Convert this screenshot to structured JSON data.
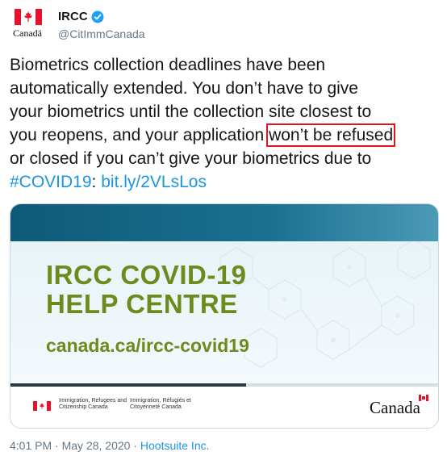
{
  "account": {
    "avatar_wordmark": "Canadä",
    "display_name": "IRCC",
    "handle": "@CitImmCanada"
  },
  "tweet": {
    "line1": "Biometrics collection deadlines have been",
    "line2": "automatically extended. You don’t have to give",
    "line3": "your biometrics until the collection site closest to",
    "line4_before": "you reopens, and your application ",
    "line4_highlight": "won’t be refused",
    "line5": "or closed if you can’t give your biometrics due to",
    "hashtag": "#COVID19",
    "separator": ": ",
    "link": "bit.ly/2VLsLos"
  },
  "card": {
    "title_line1": "IRCC COVID-19",
    "title_line2": "HELP CENTRE",
    "url": "canada.ca/ircc-covid19",
    "dept_en": "Immigration, Refugees and Citizenship Canada",
    "dept_fr": "Immigration, Réfugiés et Citoyenneté Canada",
    "wordmark": "Canada",
    "progress": 0.55,
    "colors": {
      "accent_green": "#6e8a1c",
      "top_bar": "#0e5a78",
      "flag_red": "#e8112d"
    }
  },
  "meta": {
    "time": "4:01 PM",
    "dot1": " · ",
    "date": "May 28, 2020",
    "dot2": " · ",
    "source": "Hootsuite Inc."
  },
  "colors": {
    "link": "#1b95e0",
    "highlight_box": "#e0141e",
    "secondary_text": "#657786"
  }
}
